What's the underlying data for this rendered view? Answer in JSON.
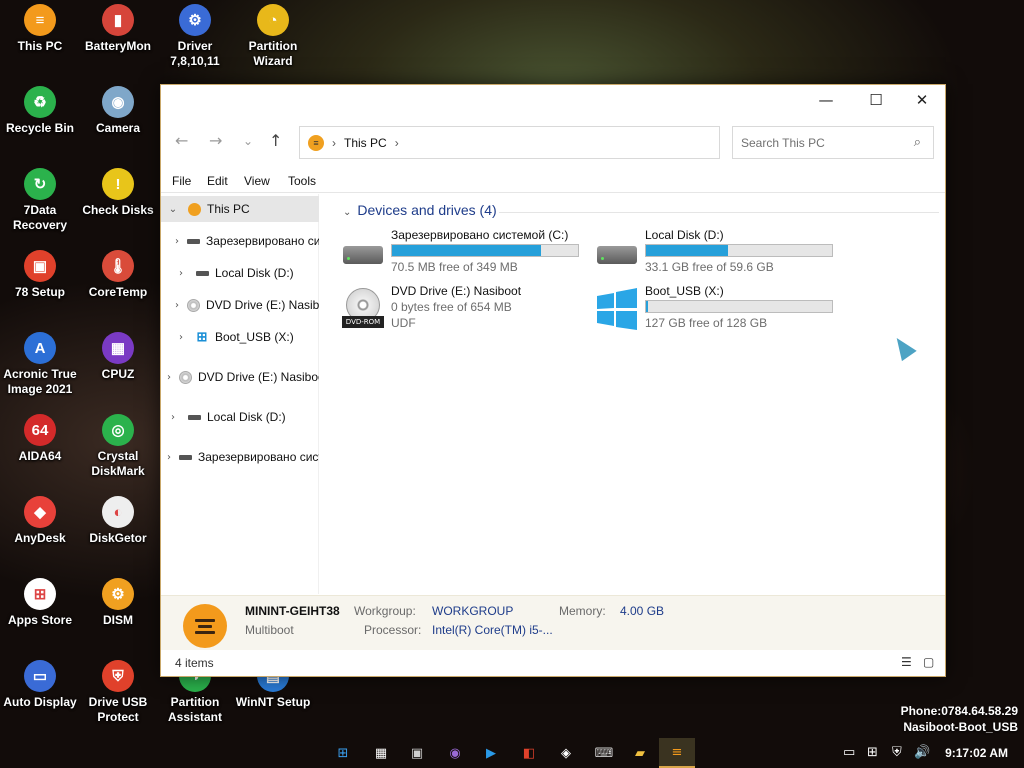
{
  "desktop": {
    "icons": [
      {
        "label": "This PC",
        "icon": "this-pc-icon",
        "color": "#f39a1c",
        "glyph": "≡"
      },
      {
        "label": "BatteryMon",
        "icon": "batterymon-icon",
        "color": "#d6453a",
        "glyph": "▮"
      },
      {
        "label": "Driver\n7,8,10,11",
        "icon": "driver-icon",
        "color": "#3a6bd6",
        "glyph": "⚙"
      },
      {
        "label": "Partition\nWizard",
        "icon": "partition-wizard-icon",
        "color": "#e8b81a",
        "glyph": "◔"
      },
      {
        "label": "Recycle Bin",
        "icon": "recycle-bin-icon",
        "color": "#2bb24c",
        "glyph": "♻"
      },
      {
        "label": "Camera",
        "icon": "camera-icon",
        "color": "#7fa7c9",
        "glyph": "◉"
      },
      {
        "label": "7Data\nRecovery",
        "icon": "7data-recovery-icon",
        "color": "#2bb24c",
        "glyph": "↻"
      },
      {
        "label": "Check Disks",
        "icon": "check-disks-icon",
        "color": "#e8c51a",
        "glyph": "!"
      },
      {
        "label": "78 Setup",
        "icon": "78-setup-icon",
        "color": "#e0412b",
        "glyph": "▣"
      },
      {
        "label": "CoreTemp",
        "icon": "coretemp-icon",
        "color": "#d94b3a",
        "glyph": "🌡"
      },
      {
        "label": "Acronic True\nImage 2021",
        "icon": "acronis-icon",
        "color": "#2c6fd6",
        "glyph": "A"
      },
      {
        "label": "CPUZ",
        "icon": "cpuz-icon",
        "color": "#7a3ac4",
        "glyph": "▦"
      },
      {
        "label": "AIDA64",
        "icon": "aida64-icon",
        "color": "#d42a2a",
        "glyph": "64"
      },
      {
        "label": "Crystal\nDiskMark",
        "icon": "crystal-diskmark-icon",
        "color": "#2bb24c",
        "glyph": "◎"
      },
      {
        "label": "AnyDesk",
        "icon": "anydesk-icon",
        "color": "#e8413a",
        "glyph": "◆"
      },
      {
        "label": "DiskGetor",
        "icon": "diskgetor-icon",
        "color": "#eeeeee",
        "glyph": "◐"
      },
      {
        "label": "Apps Store",
        "icon": "apps-store-icon",
        "color": "#ffffff",
        "glyph": "⊞"
      },
      {
        "label": "DISM",
        "icon": "dism-icon",
        "color": "#f0a020",
        "glyph": "⚙"
      },
      {
        "label": "Auto Display",
        "icon": "auto-display-icon",
        "color": "#3a6bd6",
        "glyph": "▭"
      },
      {
        "label": "Drive USB\nProtect",
        "icon": "drive-usb-protect-icon",
        "color": "#e0412b",
        "glyph": "⛨"
      },
      {
        "label": "Partition\nAssistant",
        "icon": "partition-assistant-icon",
        "color": "#2bb24c",
        "glyph": "◑"
      },
      {
        "label": "WinNT Setup",
        "icon": "winnt-setup-icon",
        "color": "#2a7bd6",
        "glyph": "▤"
      }
    ],
    "watermark_line1": "Phone:0784.64.58.29",
    "watermark_line2": "Nasiboot-Boot_USB"
  },
  "window": {
    "titlebar": {
      "minimize": "—",
      "maximize": "☐",
      "close": "✕"
    },
    "nav": {
      "back": "←",
      "forward": "→",
      "recent": "⌄",
      "up": "↑"
    },
    "address": {
      "location": "This PC",
      "sep1": "›",
      "sep2": "›"
    },
    "search": {
      "placeholder": "Search This PC"
    },
    "menu": [
      "File",
      "Edit",
      "View",
      "Tools"
    ],
    "navpane": [
      {
        "label": "This PC",
        "type": "pc",
        "indent": 0,
        "chev": "⌄",
        "selected": true
      },
      {
        "label": "Зарезервировано системой (C:)",
        "type": "drive",
        "indent": 1,
        "chev": "›"
      },
      {
        "label": "Local Disk (D:)",
        "type": "drive",
        "indent": 1,
        "chev": "›"
      },
      {
        "label": "DVD Drive (E:) Nasiboot",
        "type": "dvd",
        "indent": 1,
        "chev": "›"
      },
      {
        "label": "Boot_USB (X:)",
        "type": "win",
        "indent": 1,
        "chev": "›"
      },
      {
        "label": "DVD Drive (E:) Nasiboot",
        "type": "dvd",
        "indent": 0,
        "chev": "›"
      },
      {
        "label": "Local Disk (D:)",
        "type": "drive",
        "indent": 0,
        "chev": "›"
      },
      {
        "label": "Зарезервировано системой (C:)",
        "type": "drive",
        "indent": 0,
        "chev": "›"
      }
    ],
    "group_title": "Devices and drives (4)",
    "drives": [
      {
        "name": "Зарезервировано системой (C:)",
        "kind": "hdd",
        "used_fraction": 0.8,
        "free_text": "70.5 MB free of 349 MB"
      },
      {
        "name": "Local Disk (D:)",
        "kind": "hdd",
        "used_fraction": 0.44,
        "free_text": "33.1 GB free of 59.6 GB"
      },
      {
        "name": "DVD Drive (E:) Nasiboot",
        "kind": "dvd",
        "dvd_label": "DVD-ROM",
        "free_text": "0 bytes free of 654 MB",
        "fs": "UDF"
      },
      {
        "name": "Boot_USB (X:)",
        "kind": "win",
        "used_fraction": 0.01,
        "free_text": "127 GB free of 128 GB"
      }
    ],
    "details": {
      "pc_name": "MININT-GEIHT38",
      "subtitle": "Multiboot",
      "workgroup_key": "Workgroup:",
      "workgroup_val": "WORKGROUP",
      "memory_key": "Memory:",
      "memory_val": "4.00 GB",
      "processor_key": "Processor:",
      "processor_val": "Intel(R) Core(TM) i5-..."
    },
    "status": {
      "count": "4 items",
      "view_details": "☰",
      "view_tiles": "▢"
    }
  },
  "taskbar": {
    "apps": [
      {
        "icon": "windows-start-icon",
        "glyph": "⊞",
        "color": "#3aa0f0"
      },
      {
        "icon": "network-tool-icon",
        "glyph": "▦",
        "color": "#ffffff"
      },
      {
        "icon": "monitor-icon",
        "glyph": "▣",
        "color": "#cfcfcf"
      },
      {
        "icon": "media-icon",
        "glyph": "◉",
        "color": "#9a6ad6"
      },
      {
        "icon": "play-icon",
        "glyph": "▶",
        "color": "#2a9ae8"
      },
      {
        "icon": "tool-icon",
        "glyph": "◧",
        "color": "#e0412b"
      },
      {
        "icon": "diamond-icon",
        "glyph": "◈",
        "color": "#ffffff"
      },
      {
        "icon": "keyboard-icon",
        "glyph": "⌨",
        "color": "#cfcfcf"
      },
      {
        "icon": "folder-icon",
        "glyph": "▰",
        "color": "#f0c040"
      },
      {
        "icon": "this-pc-taskbar-icon",
        "glyph": "≡",
        "color": "#f39a1c",
        "active": true
      }
    ],
    "tray": [
      "▭",
      "⊞",
      "⛨",
      "🔊"
    ],
    "clock": "9:17:02 AM"
  }
}
